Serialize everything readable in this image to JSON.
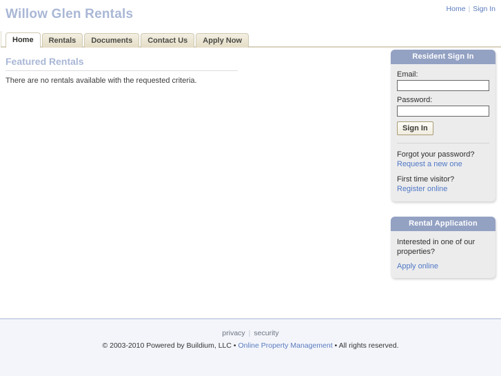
{
  "header": {
    "site_title": "Willow Glen Rentals",
    "top_links": [
      {
        "label": "Home"
      },
      {
        "label": "Sign In"
      }
    ],
    "separator": "|"
  },
  "nav": {
    "tabs": [
      {
        "label": "Home",
        "active": true
      },
      {
        "label": "Rentals",
        "active": false
      },
      {
        "label": "Documents",
        "active": false
      },
      {
        "label": "Contact Us",
        "active": false
      },
      {
        "label": "Apply Now",
        "active": false
      }
    ]
  },
  "main": {
    "section_title": "Featured Rentals",
    "empty_message": "There are no rentals available with the requested criteria."
  },
  "sidebar": {
    "signin_panel": {
      "title": "Resident Sign In",
      "email_label": "Email:",
      "email_value": "",
      "password_label": "Password:",
      "password_value": "",
      "submit_label": "Sign In",
      "forgot_prompt": "Forgot your password?",
      "forgot_link": "Request a new one",
      "first_time_prompt": "First time visitor?",
      "register_link": "Register online"
    },
    "application_panel": {
      "title": "Rental Application",
      "prompt": "Interested in one of our properties?",
      "apply_link": "Apply online"
    }
  },
  "footer": {
    "privacy_label": "privacy",
    "security_label": "security",
    "separator": "|",
    "copyright_prefix": "© 2003-2010 Powered by Buildium, LLC • ",
    "copyright_link": "Online Property Management",
    "copyright_suffix": " • All rights reserved."
  },
  "colors": {
    "title_blue": "#a9b7d6",
    "panel_header": "#93a1c3",
    "tab_border": "#cfc8b0",
    "link_blue": "#4f77c4",
    "footer_bg": "#f3f5fa"
  }
}
